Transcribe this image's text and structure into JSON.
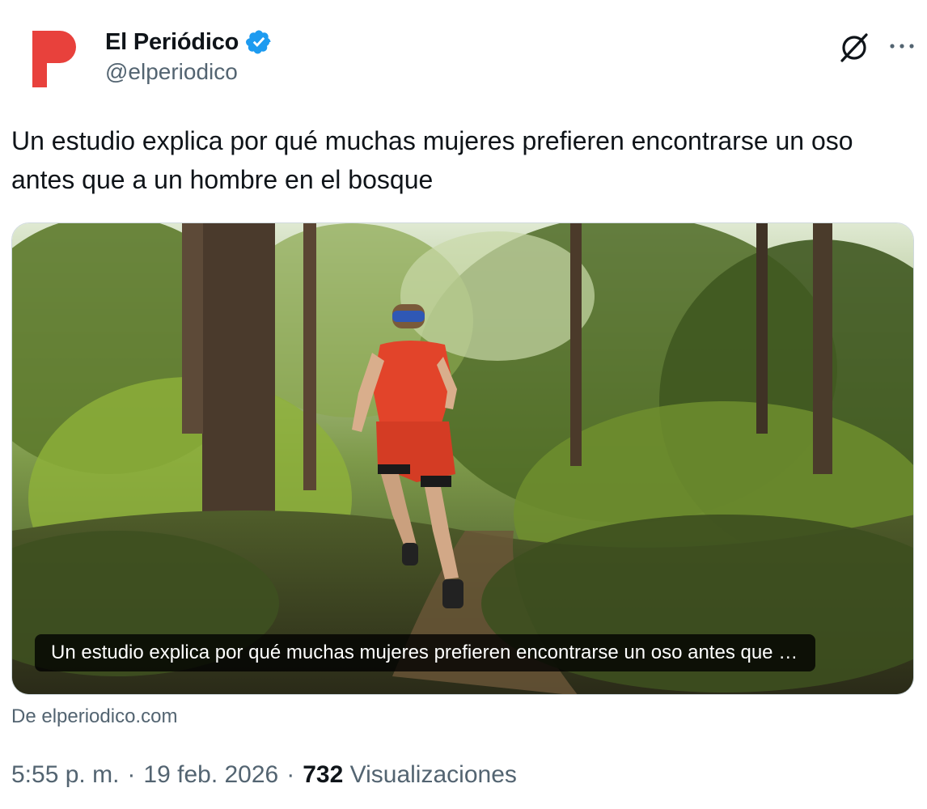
{
  "author": {
    "display_name": "El Periódico",
    "handle": "@elperiodico",
    "avatar_icon": "el-periodico-logo-icon",
    "verified_icon": "verified-badge-icon",
    "brand_color": "#e8413c",
    "verified_color": "#1d9bf0"
  },
  "actions": {
    "grok_icon": "grok-icon",
    "more_icon": "more-horizontal-icon"
  },
  "tweet": {
    "text": "Un estudio explica por qué muchas mujeres prefieren encontrarse un oso antes que a un hombre en el bosque"
  },
  "link_card": {
    "title": "Un estudio explica por qué muchas mujeres prefieren encontrarse un oso antes que …",
    "source": "De elperiodico.com"
  },
  "meta": {
    "time": "5:55 p. m.",
    "sep1": "·",
    "date": "19 feb. 2026",
    "sep2": "·",
    "views_count": "732",
    "views_label": "Visualizaciones"
  }
}
